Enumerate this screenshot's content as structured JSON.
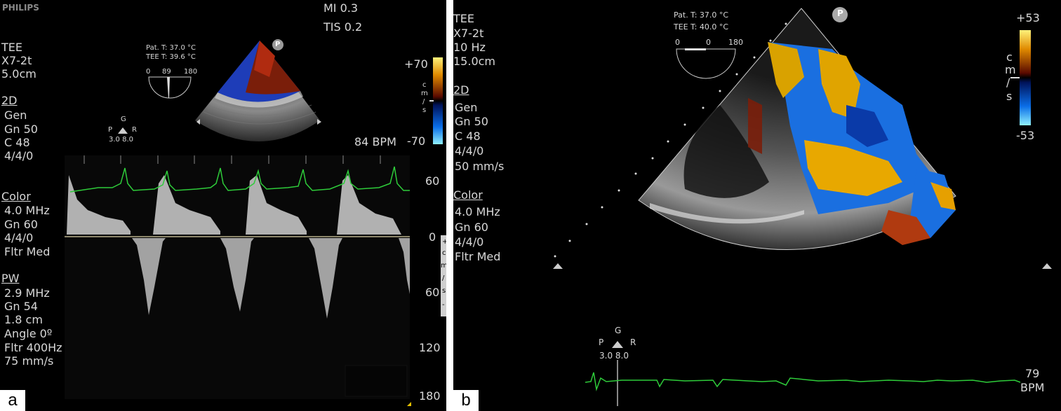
{
  "panel_a": {
    "brand": "PHILIPS",
    "mi": "MI 0.3",
    "tis": "TIS 0.2",
    "probe": [
      "TEE",
      "X7-2t",
      "5.0cm"
    ],
    "mode_2d_title": "2D",
    "mode_2d": [
      "Gen",
      "Gn 50",
      "C 48",
      "4/4/0"
    ],
    "color_title": "Color",
    "color": [
      "4.0 MHz",
      "Gn 60",
      "4/4/0",
      "Fltr Med"
    ],
    "pw_title": "PW",
    "pw": [
      "2.9 MHz",
      "Gn 54",
      "1.8 cm",
      "Angle 0º",
      "Fltr 400Hz",
      "75 mm/s"
    ],
    "pat_t": "Pat. T: 37.0 °C",
    "tee_t": "TEE T: 39.6 °C",
    "angle_scale": [
      "0",
      "89",
      "180"
    ],
    "orient": {
      "g": "G",
      "p": "P",
      "r": "R",
      "vals": "3.0 8.0"
    },
    "color_scale_top": "+70",
    "color_scale_bottom": "-70",
    "color_unit": [
      "c",
      "m",
      "/",
      "s"
    ],
    "bpm": "84 BPM",
    "axis_labels": [
      "60",
      "0",
      "60",
      "120",
      "180"
    ],
    "velocity_unit": [
      "+",
      "c",
      "m",
      "/",
      "s",
      "-"
    ],
    "probe_marker": "P",
    "figure_label": "a"
  },
  "panel_b": {
    "probe": [
      "TEE",
      "X7-2t",
      "10 Hz",
      "15.0cm"
    ],
    "mode_2d_title": "2D",
    "mode_2d": [
      "Gen",
      "Gn 50",
      "C 48",
      "4/4/0",
      "50 mm/s"
    ],
    "color_title": "Color",
    "color": [
      "4.0 MHz",
      "Gn 60",
      "4/4/0",
      "Fltr Med"
    ],
    "pat_t": "Pat. T: 37.0 °C",
    "tee_t": "TEE T: 40.0 °C",
    "angle_scale": [
      "0",
      "0",
      "180"
    ],
    "color_scale_top": "+53",
    "color_scale_bottom": "-53",
    "color_unit": [
      "c",
      "m",
      "/",
      "s"
    ],
    "orient": {
      "g": "G",
      "p": "P",
      "r": "R",
      "vals": "3.0 8.0"
    },
    "bpm_value": "79",
    "bpm_unit": "BPM",
    "probe_marker": "P",
    "figure_label": "b"
  }
}
